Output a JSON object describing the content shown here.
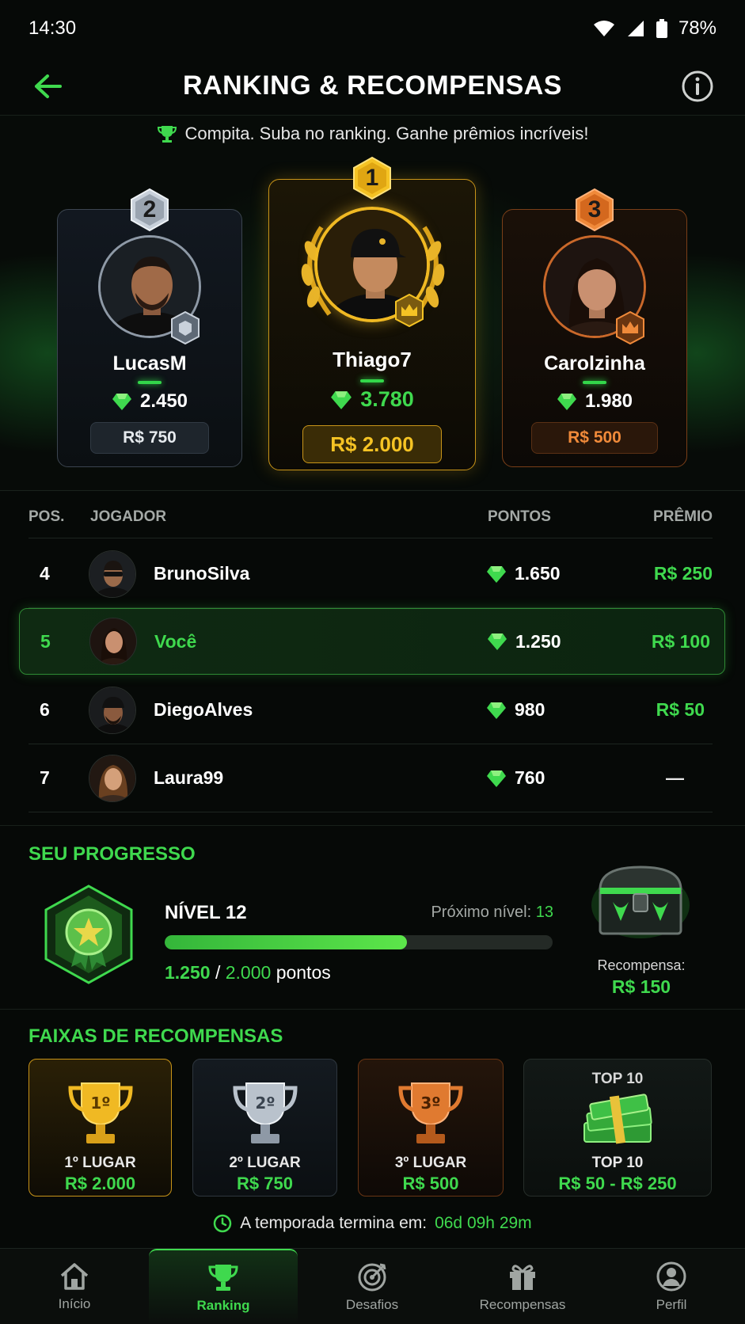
{
  "status_bar": {
    "time": "14:30",
    "battery": "78%"
  },
  "header": {
    "title": "RANKING & RECOMPENSAS"
  },
  "hero": {
    "tagline": "Compita. Suba no ranking. Ganhe prêmios incríveis!"
  },
  "podium": {
    "first": {
      "rank": "1",
      "name": "Thiago7",
      "points": "3.780",
      "prize": "R$ 2.000"
    },
    "second": {
      "rank": "2",
      "name": "LucasM",
      "points": "2.450",
      "prize": "R$ 750"
    },
    "third": {
      "rank": "3",
      "name": "Carolzinha",
      "points": "1.980",
      "prize": "R$ 500"
    }
  },
  "table": {
    "headers": {
      "pos": "POS.",
      "player": "JOGADOR",
      "points": "PONTOS",
      "prize": "PRÊMIO"
    },
    "rows": [
      {
        "pos": "4",
        "name": "BrunoSilva",
        "points": "1.650",
        "prize": "R$ 250"
      },
      {
        "pos": "5",
        "name": "Você",
        "points": "1.250",
        "prize": "R$ 100"
      },
      {
        "pos": "6",
        "name": "DiegoAlves",
        "points": "980",
        "prize": "R$ 50"
      },
      {
        "pos": "7",
        "name": "Laura99",
        "points": "760",
        "prize": "—"
      }
    ]
  },
  "progress": {
    "title": "SEU PROGRESSO",
    "level": "NÍVEL 12",
    "next_label": "Próximo nível:",
    "next_value": "13",
    "current_points": "1.250",
    "separator": "/",
    "target_points": "2.000",
    "points_word": "pontos",
    "fraction": 0.625,
    "reward_label": "Recompensa:",
    "reward_value": "R$ 150"
  },
  "tiers": {
    "title": "FAIXAS DE RECOMPENSAS",
    "items": [
      {
        "label": "1º LUGAR",
        "value": "R$ 2.000",
        "cup_text": "1º"
      },
      {
        "label": "2º LUGAR",
        "value": "R$ 750",
        "cup_text": "2º"
      },
      {
        "label": "3º LUGAR",
        "value": "R$ 500",
        "cup_text": "3º"
      },
      {
        "top_label": "TOP 10",
        "label": "TOP 10",
        "value": "R$ 50 - R$ 250"
      }
    ]
  },
  "season": {
    "label": "A temporada termina em:",
    "remaining": "06d 09h 29m"
  },
  "nav": {
    "items": [
      {
        "label": "Início",
        "icon": "home-icon"
      },
      {
        "label": "Ranking",
        "icon": "trophy-icon"
      },
      {
        "label": "Desafios",
        "icon": "target-icon"
      },
      {
        "label": "Recompensas",
        "icon": "gift-icon"
      },
      {
        "label": "Perfil",
        "icon": "user-icon"
      }
    ]
  },
  "colors": {
    "accent": "#3fd94e",
    "gold": "#f5c324",
    "silver": "#c9d1db",
    "bronze": "#f08a3a",
    "background": "#060907"
  }
}
